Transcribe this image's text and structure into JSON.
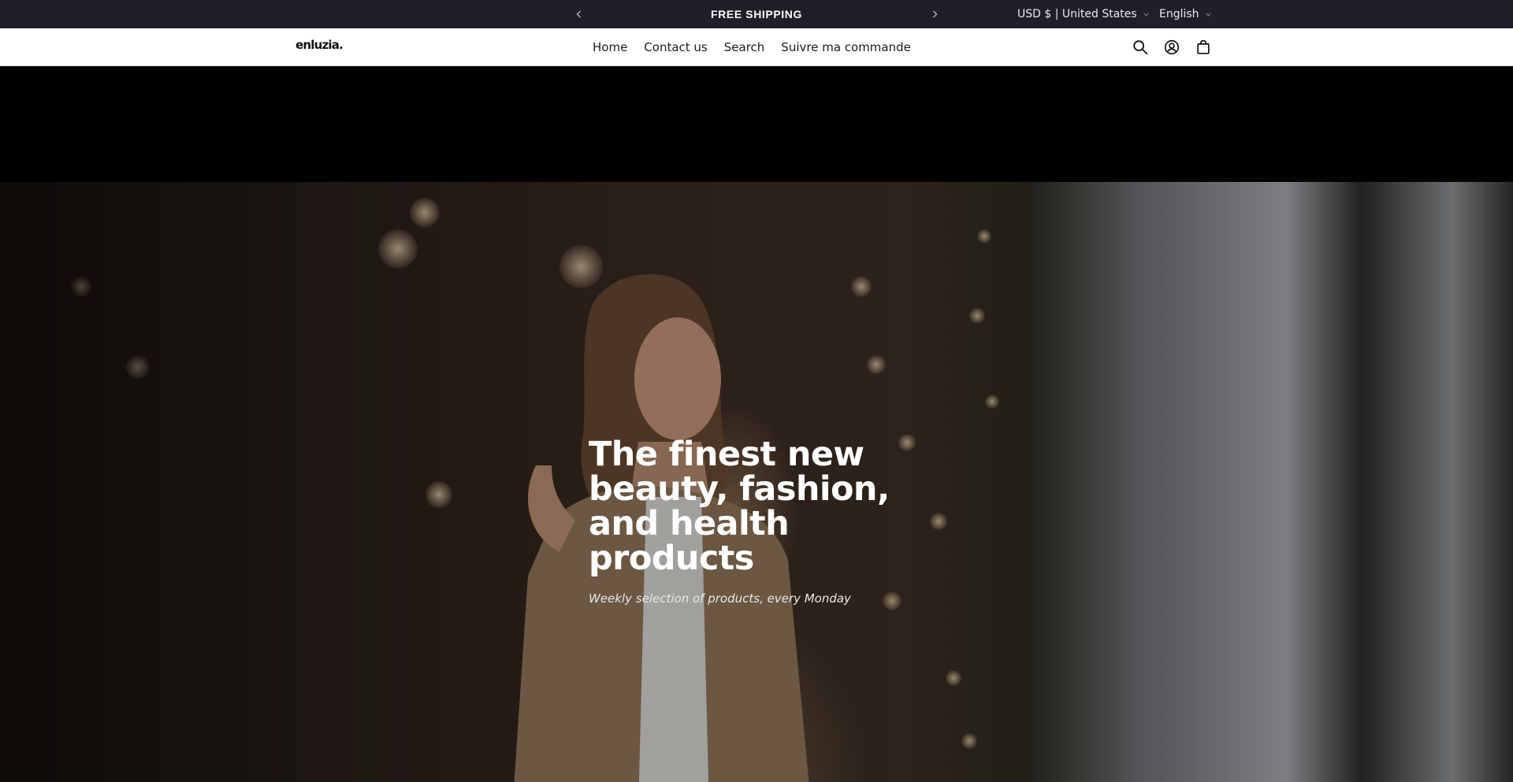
{
  "announcement": {
    "message": "FREE SHIPPING",
    "prev_icon": "chevron-left-icon",
    "next_icon": "chevron-right-icon"
  },
  "locale": {
    "country": "USD $ | United States",
    "language": "English"
  },
  "header": {
    "logo": "enluzia.",
    "nav": [
      "Home",
      "Contact us",
      "Search",
      "Suivre ma commande"
    ],
    "icons": [
      "search-icon",
      "account-icon",
      "cart-icon"
    ]
  },
  "hero": {
    "title": "The finest new beauty, fashion, and health products",
    "subtitle": "Weekly selection of products, every Monday"
  },
  "colors": {
    "announcement_bg": "#1f1f29",
    "header_bg": "#ffffff",
    "spacer_bg": "#000000",
    "text_dark": "#1a1a1a",
    "text_light": "#ffffff"
  }
}
